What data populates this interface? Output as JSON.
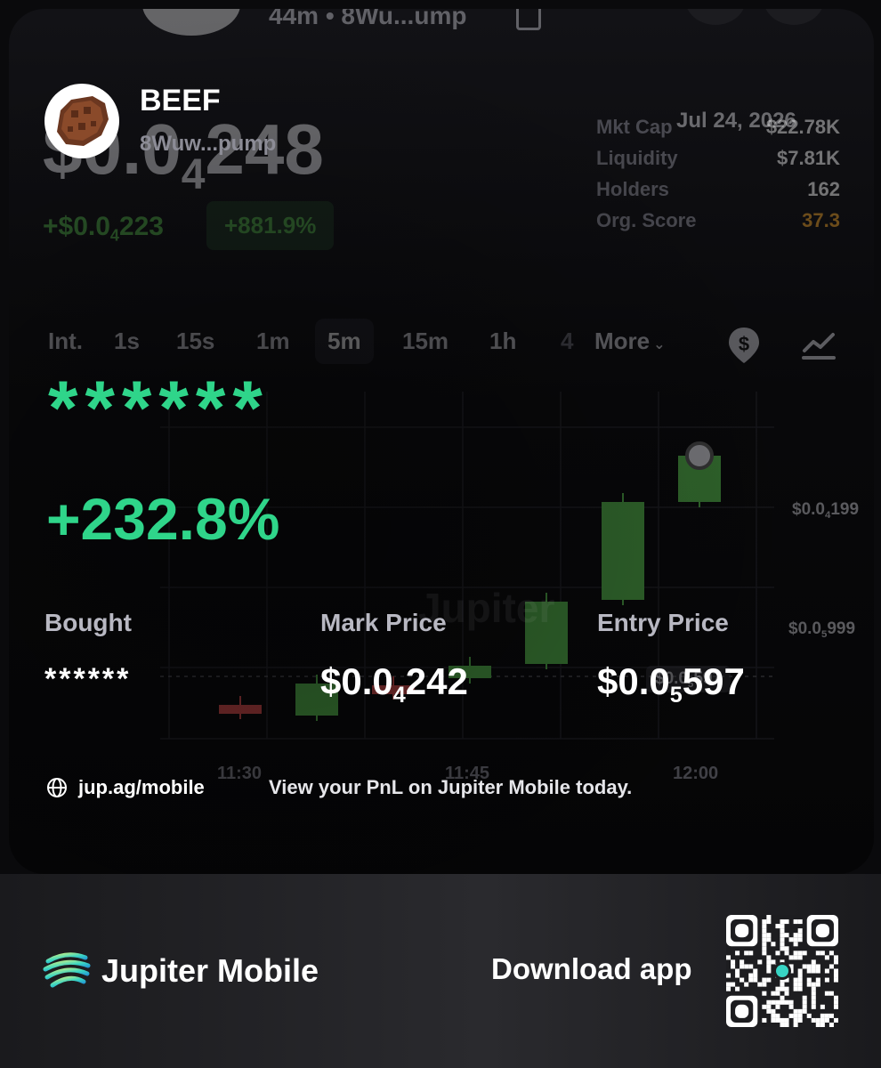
{
  "background": {
    "header_meta": "44m • 8Wu...ump",
    "price_main": "$0.0",
    "price_sub": "4",
    "price_tail": "248",
    "change_main": "+$0.0",
    "change_sub": "4",
    "change_tail": "223",
    "change_pct": "+881.9%",
    "date": "Jul 24, 2026",
    "stats": [
      {
        "label": "Mkt Cap",
        "value": "$22.78K"
      },
      {
        "label": "Liquidity",
        "value": "$7.81K"
      },
      {
        "label": "Holders",
        "value": "162"
      },
      {
        "label": "Org. Score",
        "value": "37.3"
      }
    ],
    "timeframes": [
      "Int.",
      "1s",
      "15s",
      "1m",
      "5m",
      "15m",
      "1h",
      "4"
    ],
    "active_timeframe": "5m",
    "more_label": "More",
    "y_ticks": [
      {
        "main": "$0.0",
        "sub": "4",
        "tail": "199"
      },
      {
        "main": "$0.0",
        "sub": "5",
        "tail": "999"
      }
    ],
    "x_ticks": [
      "11:30",
      "11:45",
      "12:00"
    ],
    "entry_tag": {
      "main": "$0.0",
      "sub": "5",
      "tail": "597"
    },
    "watermark": "Jupiter",
    "colors": {
      "up": "#53b34a",
      "down": "#d24a4a",
      "score": "#f0a32b"
    }
  },
  "token": {
    "name": "BEEF",
    "address": "8Wuw...pump"
  },
  "pnl": {
    "hidden_amount": "******",
    "percent": "+232.8%"
  },
  "columns": [
    {
      "label": "Bought",
      "value": "******"
    },
    {
      "label": "Mark Price",
      "main": "$0.0",
      "sub": "4",
      "tail": "242"
    },
    {
      "label": "Entry Price",
      "main": "$0.0",
      "sub": "5",
      "tail": "597"
    }
  ],
  "footer": {
    "link": "jup.ag/mobile",
    "tagline": "View your PnL on Jupiter Mobile today."
  },
  "bottom": {
    "brand": "Jupiter Mobile",
    "cta": "Download app"
  }
}
